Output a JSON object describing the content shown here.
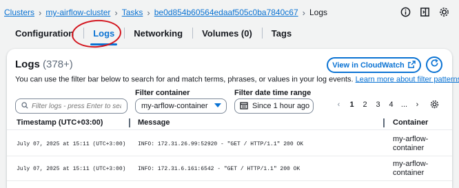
{
  "breadcrumb": {
    "items": [
      "Clusters",
      "my-airflow-cluster",
      "Tasks",
      "be0d854b60564edaaf505c0ba7840c67"
    ],
    "current": "Logs"
  },
  "tabs": [
    {
      "label": "Configuration",
      "active": false
    },
    {
      "label": "Logs",
      "active": true
    },
    {
      "label": "Networking",
      "active": false
    },
    {
      "label": "Volumes (0)",
      "active": false
    },
    {
      "label": "Tags",
      "active": false
    }
  ],
  "panel": {
    "title": "Logs",
    "count": "(378+)",
    "description": "You can use the filter bar below to search for and match terms, phrases, or values in your log events.",
    "learn_more": "Learn more about filter patterns",
    "cloudwatch_button": "View in CloudWatch"
  },
  "filters": {
    "search_placeholder": "Filter logs - press Enter to sea",
    "container_label": "Filter container",
    "container_value": "my-arflow-container",
    "date_label": "Filter date time range",
    "date_value": "Since 1 hour ago"
  },
  "pagination": {
    "pages": [
      "1",
      "2",
      "3",
      "4",
      "..."
    ],
    "current": "1"
  },
  "table": {
    "columns": [
      "Timestamp (UTC+03:00)",
      "Message",
      "Container"
    ],
    "rows": [
      {
        "timestamp": "July 07, 2025 at 15:11 (UTC+3:00)",
        "message": "INFO: 172.31.26.99:52920 - \"GET / HTTP/1.1\" 200 OK",
        "container": "my-arflow-container"
      },
      {
        "timestamp": "July 07, 2025 at 15:11 (UTC+3:00)",
        "message": "INFO: 172.31.6.161:6542 - \"GET / HTTP/1.1\" 200 OK",
        "container": "my-arflow-container"
      }
    ]
  },
  "colors": {
    "link": "#0972d3",
    "annotation": "#d3151e",
    "background": "#f2f3f3"
  },
  "icons": [
    "chevron-right-icon",
    "info-icon",
    "split-panel-icon",
    "gear-icon",
    "external-link-icon",
    "refresh-icon",
    "search-icon",
    "caret-down-icon",
    "calendar-icon",
    "chevron-left-icon"
  ]
}
